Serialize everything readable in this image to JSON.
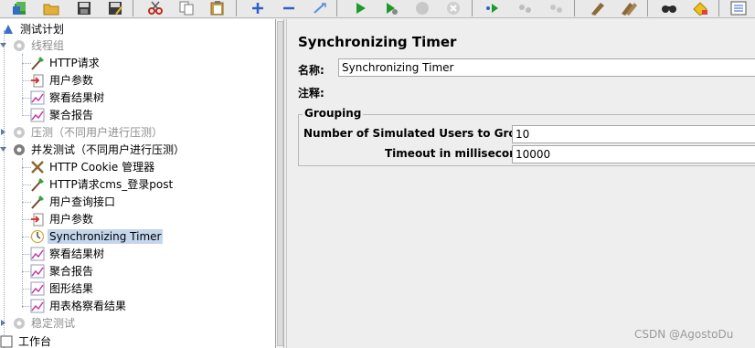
{
  "toolbar": {
    "buttons": [
      {
        "icon": "book-icon"
      },
      {
        "icon": "open-folder-icon"
      },
      {
        "icon": "save-icon"
      },
      {
        "icon": "save-as-icon"
      },
      {
        "icon": "cut-icon"
      },
      {
        "icon": "copy-icon"
      },
      {
        "icon": "paste-icon"
      },
      {
        "icon": "expand-icon"
      },
      {
        "icon": "collapse-icon"
      },
      {
        "icon": "toggle-icon"
      },
      {
        "icon": "start-icon"
      },
      {
        "icon": "start-no-pause-icon"
      },
      {
        "icon": "stop-icon"
      },
      {
        "icon": "shutdown-icon"
      },
      {
        "icon": "remote-start-icon"
      },
      {
        "icon": "remote-stop-icon"
      },
      {
        "icon": "remote-shutdown-icon"
      },
      {
        "icon": "clear-icon"
      },
      {
        "icon": "clear-all-icon"
      },
      {
        "icon": "search-icon"
      },
      {
        "icon": "reset-search-icon"
      },
      {
        "icon": "function-helper-icon"
      }
    ]
  },
  "tree": {
    "root_label": "测试计划",
    "nodes": [
      {
        "label": "线程组",
        "icon": "thread-group-icon",
        "disabled": true
      },
      {
        "label": "HTTP请求",
        "icon": "http-sampler-icon"
      },
      {
        "label": "用户参数",
        "icon": "user-params-icon"
      },
      {
        "label": "察看结果树",
        "icon": "results-tree-icon"
      },
      {
        "label": "聚合报告",
        "icon": "aggregate-report-icon"
      },
      {
        "label": "压测（不同用户进行压测）",
        "icon": "thread-group-icon",
        "disabled": true
      },
      {
        "label": "并发测试（不同用户进行压测）",
        "icon": "thread-group-icon"
      },
      {
        "label": "HTTP Cookie 管理器",
        "icon": "cookie-manager-icon"
      },
      {
        "label": "HTTP请求cms_登录post",
        "icon": "http-sampler-icon"
      },
      {
        "label": "用户查询接口",
        "icon": "http-sampler-icon"
      },
      {
        "label": "用户参数",
        "icon": "user-params-icon"
      },
      {
        "label": "Synchronizing Timer",
        "icon": "timer-icon",
        "selected": true
      },
      {
        "label": "察看结果树",
        "icon": "results-tree-icon"
      },
      {
        "label": "聚合报告",
        "icon": "aggregate-report-icon"
      },
      {
        "label": "图形结果",
        "icon": "graph-results-icon"
      },
      {
        "label": "用表格察看结果",
        "icon": "table-results-icon"
      },
      {
        "label": "稳定测试",
        "icon": "thread-group-icon",
        "disabled": true
      },
      {
        "label": "工作台",
        "icon": "workbench-icon"
      }
    ]
  },
  "panel": {
    "title": "Synchronizing Timer",
    "name_label": "名称:",
    "name_value": "Synchronizing Timer",
    "comment_label": "注释:",
    "comment_value": "",
    "group_title": "Grouping",
    "users_label": "Number of Simulated Users to Group by:",
    "users_value": "10",
    "timeout_label": "Timeout in milliseconds:",
    "timeout_value": "10000"
  },
  "watermark": "CSDN @AgostoDu"
}
